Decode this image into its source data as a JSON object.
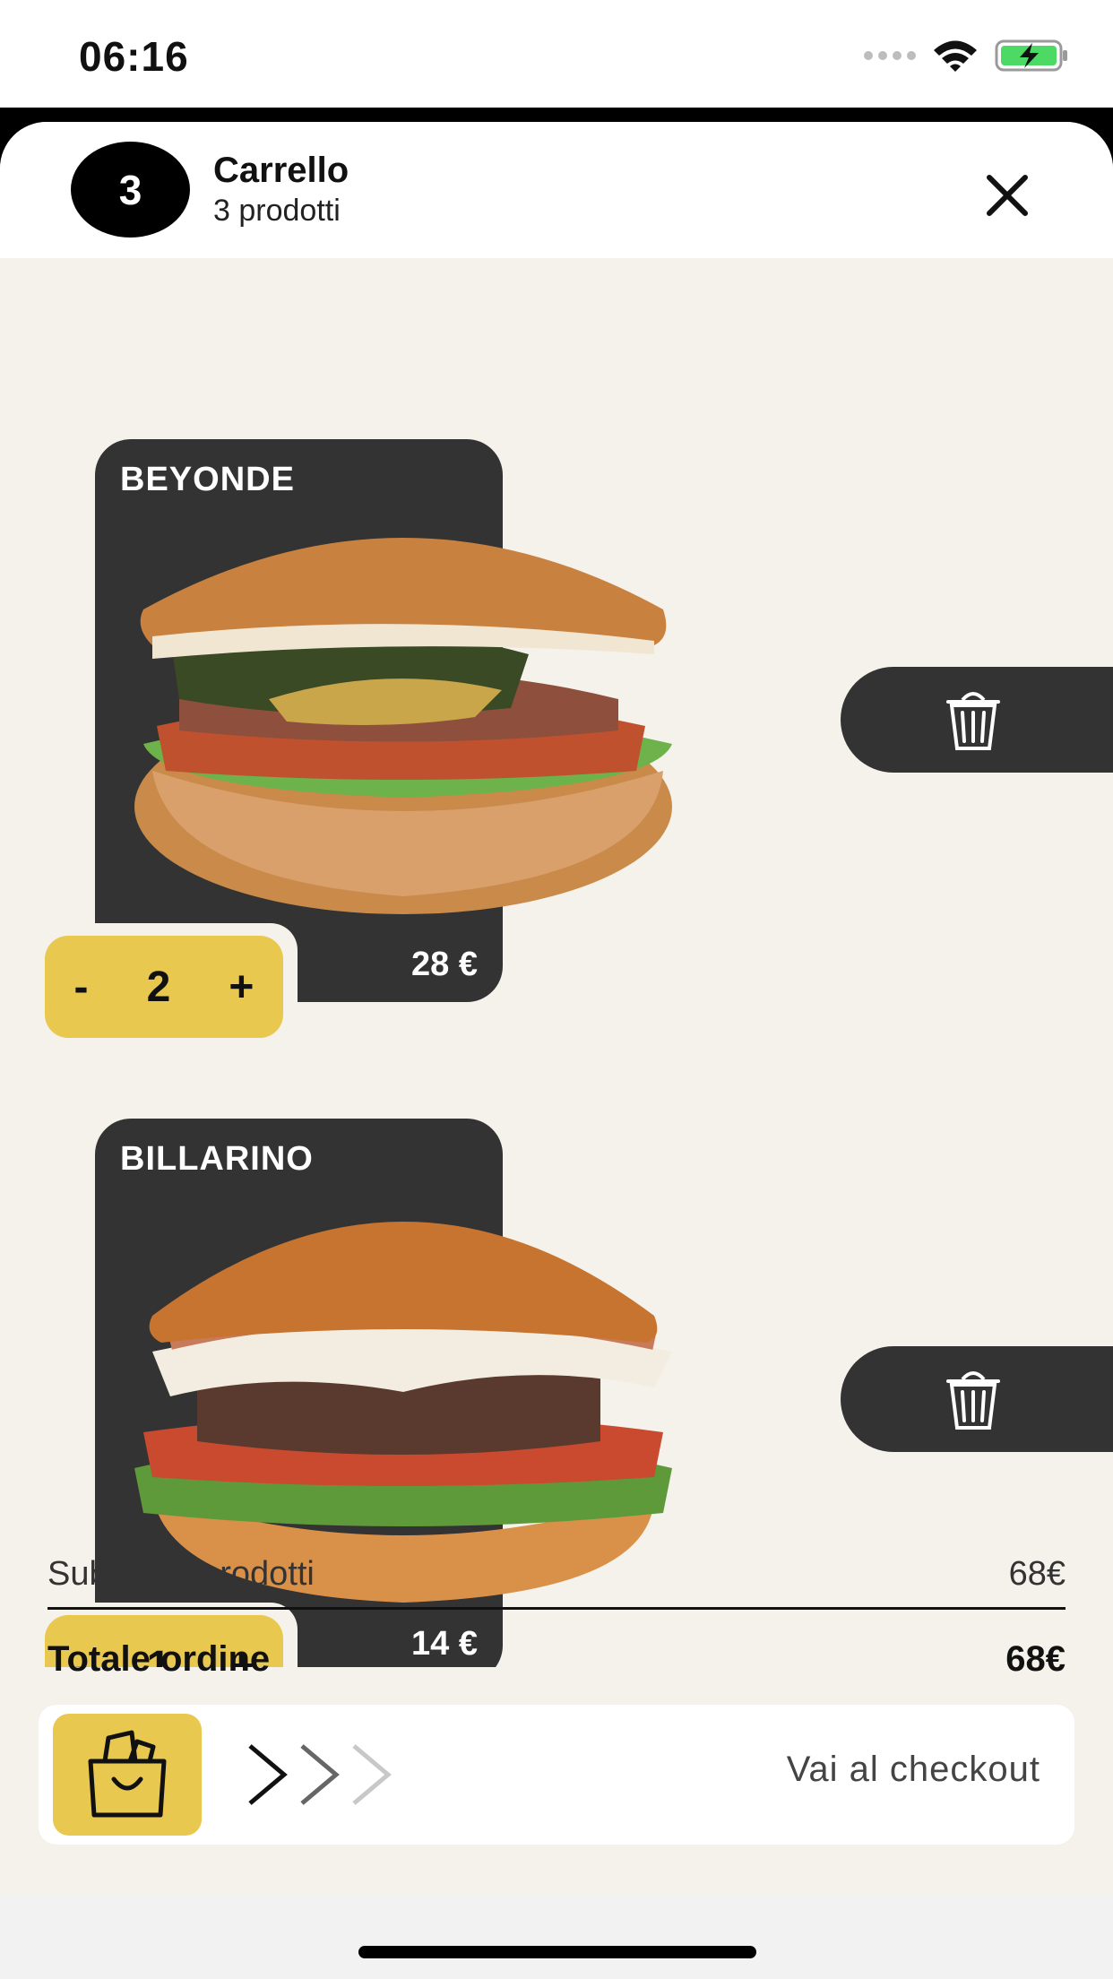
{
  "status_bar": {
    "time": "06:16",
    "icons": [
      "signal-dots-icon",
      "wifi-icon",
      "battery-charging-icon"
    ]
  },
  "header": {
    "count": "3",
    "title": "Carrello",
    "subtitle": "3 prodotti",
    "close_icon": "close-icon"
  },
  "items": [
    {
      "name": "BEYONDE",
      "price": "28 €",
      "qty_minus": "-",
      "quantity": "2",
      "qty_plus": "+",
      "trash_icon": "trash-icon"
    },
    {
      "name": "BILLARINO",
      "price": "14 €",
      "qty_minus": "-",
      "quantity": "1",
      "qty_plus": "+",
      "trash_icon": "trash-icon"
    }
  ],
  "summary": {
    "subtotal_label": "Subtotale prodotti",
    "subtotal_value": "68€",
    "total_label": "Totale ordine",
    "total_value": "68€"
  },
  "checkout": {
    "label": "Vai al checkout",
    "icon": "shopping-bag-icon"
  },
  "colors": {
    "accent": "#e9c84f",
    "card": "#333333",
    "background": "#f5f2ec"
  }
}
